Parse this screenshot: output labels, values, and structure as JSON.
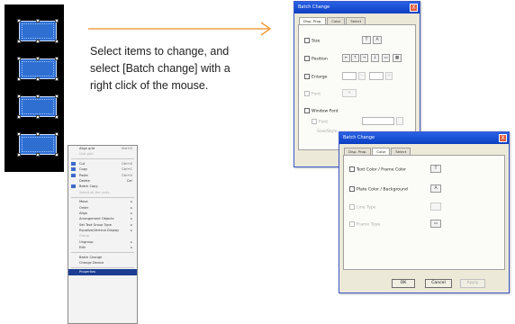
{
  "instruction": {
    "line1": "Select items to change, and",
    "line2": "select [Batch change] with a",
    "line3": "right click of the mouse."
  },
  "context_menu": {
    "items": [
      {
        "label": "Align grid",
        "shortcut": "Ctrl+G"
      },
      {
        "label": "Unit grid",
        "shortcut": "",
        "disabled": true
      },
      {
        "sep": true
      },
      {
        "label": "Cut",
        "shortcut": "Ctrl+X"
      },
      {
        "label": "Copy",
        "shortcut": "Ctrl+C"
      },
      {
        "label": "Paste",
        "shortcut": "Ctrl+V"
      },
      {
        "label": "Delete",
        "shortcut": "Del"
      },
      {
        "label": "Batch Copy",
        "shortcut": ""
      },
      {
        "label": "Select all the units",
        "shortcut": "",
        "disabled": true
      },
      {
        "sep": true
      },
      {
        "label": "Move",
        "shortcut": "▸"
      },
      {
        "label": "Order",
        "shortcut": "▸"
      },
      {
        "label": "Align",
        "shortcut": "▸"
      },
      {
        "label": "Arrangement Objects",
        "shortcut": "▸"
      },
      {
        "label": "Set Text Group Type",
        "shortcut": "▸"
      },
      {
        "label": "Equalize/Vertical Display",
        "shortcut": "▸"
      },
      {
        "label": "Group",
        "shortcut": "",
        "disabled": true
      },
      {
        "label": "Ungroup",
        "shortcut": "▸"
      },
      {
        "label": "Edit",
        "shortcut": "▸"
      },
      {
        "sep": true
      },
      {
        "label": "Batch Change",
        "shortcut": ""
      },
      {
        "label": "Change Device",
        "shortcut": ""
      },
      {
        "sep": true
      },
      {
        "label": "Properties",
        "shortcut": "",
        "selected": true
      }
    ]
  },
  "dialog1": {
    "title": "Batch Change",
    "close": "X",
    "tabs": [
      "Disp. Prop.",
      "Color",
      "Select"
    ],
    "rows": [
      {
        "label": "Size",
        "dim": false
      },
      {
        "label": "Position",
        "dim": false
      },
      {
        "label": "Enlarge",
        "dim": false
      },
      {
        "label": "Font",
        "dim": true
      },
      {
        "label": "Window Font",
        "dim": false
      },
      {
        "label": "Font",
        "dim": true
      },
      {
        "label": "Size/Style",
        "dim": true
      }
    ],
    "btn_size_a": "T",
    "btn_size_b": "A",
    "pos_buttons": [
      "←",
      "↑",
      "→",
      "↓",
      "▭",
      "▦"
    ],
    "enlarge_minus": "−",
    "enlarge_plus": "+",
    "font_val": "▾"
  },
  "dialog2": {
    "title": "Batch Change",
    "close": "X",
    "tabs": [
      "Disp. Prop.",
      "Color",
      "Select"
    ],
    "rows": [
      {
        "label": "Text Color / Frame Color",
        "dim": false
      },
      {
        "label": "Plate Color / Background",
        "dim": false
      },
      {
        "label": "Line Type",
        "dim": true
      },
      {
        "label": "Frame Type",
        "dim": true
      }
    ],
    "ctl_text_color": "T",
    "ctl_plate_color": "A",
    "ctl_frame_type": "▭",
    "ok": "OK",
    "cancel": "Cancel",
    "apply": "Apply"
  },
  "colors": {
    "selection_blue": "#2f6fd2",
    "arrow_orange": "#f08a1c",
    "titlebar_blue": "#0b3fc2",
    "menu_highlight": "#1b3d92"
  }
}
